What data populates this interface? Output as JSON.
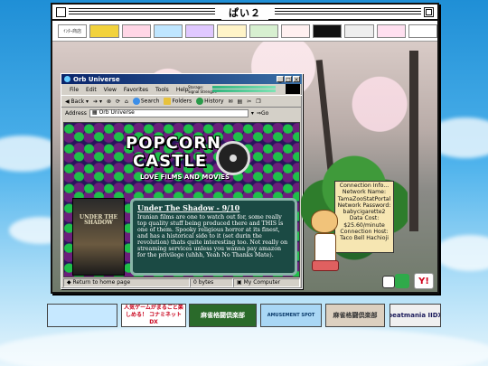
{
  "outer_window": {
    "title": "ぱい２"
  },
  "top_banners": [
    {
      "label": "ｲﾝﾀｰ商店",
      "bg": "#ffffff",
      "fg": "#333333"
    },
    {
      "label": "",
      "bg": "#f2d23c",
      "fg": "#333333"
    },
    {
      "label": "",
      "bg": "#ffd6e6",
      "fg": "#333333"
    },
    {
      "label": "",
      "bg": "#bfe6ff",
      "fg": "#333333"
    },
    {
      "label": "",
      "bg": "#e0c8ff",
      "fg": "#333333"
    },
    {
      "label": "",
      "bg": "#fff4c8",
      "fg": "#333333"
    },
    {
      "label": "",
      "bg": "#d7f0d0",
      "fg": "#333333"
    },
    {
      "label": "",
      "bg": "#fff0f0",
      "fg": "#333333"
    },
    {
      "label": "",
      "bg": "#111111",
      "fg": "#ffffff"
    },
    {
      "label": "",
      "bg": "#eeeeee",
      "fg": "#333333"
    },
    {
      "label": "",
      "bg": "#ffe0f0",
      "fg": "#333333"
    },
    {
      "label": "",
      "bg": "#ffffff",
      "fg": "#333333"
    }
  ],
  "browser": {
    "title": "Orb Universe",
    "menu": [
      "File",
      "Edit",
      "View",
      "Favorites",
      "Tools",
      "Help"
    ],
    "signal_labels": [
      "Storage:",
      "Signal Strength:"
    ],
    "toolbar": [
      "Back",
      "Search",
      "Folders",
      "History"
    ],
    "address_label": "Address",
    "address_value": "Orb Universe",
    "status_link": "Return to home page",
    "status_bytes": "0 bytes",
    "status_zone": "My Computer"
  },
  "page": {
    "logo_line1": "POPCORN",
    "logo_line2": "CASTLE",
    "tagline": "LOVE FILMS AND MOVIES",
    "poster_title": "UNDER THE SHADOW",
    "review_heading": "Under The Shadow - 9/10",
    "review_body": "Iranian films are one to watch out for, some really top quality stuff being produced there and THIS is one of them. Spooky religious horror at its finest, and has a historical side to it (set durin the revolution) thats quite interesting too. Not really on streaming services unless you wanna pay amazon for the privilege (uhhh, Yeah No Thanks Mate)."
  },
  "connection_info": [
    "Connection Info...",
    "Network Name:",
    "TamaZooStatPortal",
    "Network Password:",
    "babycigarette2",
    "Data Cost:",
    "$25.60/minute",
    "Connection Host:",
    "Taco Bell Hachioji"
  ],
  "bottom_banners": [
    {
      "label": "",
      "bg": "#c6e8ff",
      "fg": "#0a3a8a"
    },
    {
      "label": "人気ゲームがまるごと楽しめる！ コナミネットDX",
      "bg": "#ffffff",
      "fg": "#c8001a"
    },
    {
      "label": "麻雀格闘倶楽部",
      "bg": "#2a6a2a",
      "fg": "#ffffff"
    },
    {
      "label": "AMUSEMENT SPOT",
      "bg": "#a9d7f5",
      "fg": "#0a3a6a"
    },
    {
      "label": "麻雀格闘倶楽部",
      "bg": "#dcd0c0",
      "fg": "#333333"
    },
    {
      "label": "beatmania IIDX",
      "bg": "#f0f0f0",
      "fg": "#1a1a5a"
    }
  ],
  "colors": {
    "sky_top": "#1f8fd6",
    "ie_title": "#0a246a",
    "review_bg": "#1b4a44",
    "infobox_bg": "#f6e6b2"
  }
}
